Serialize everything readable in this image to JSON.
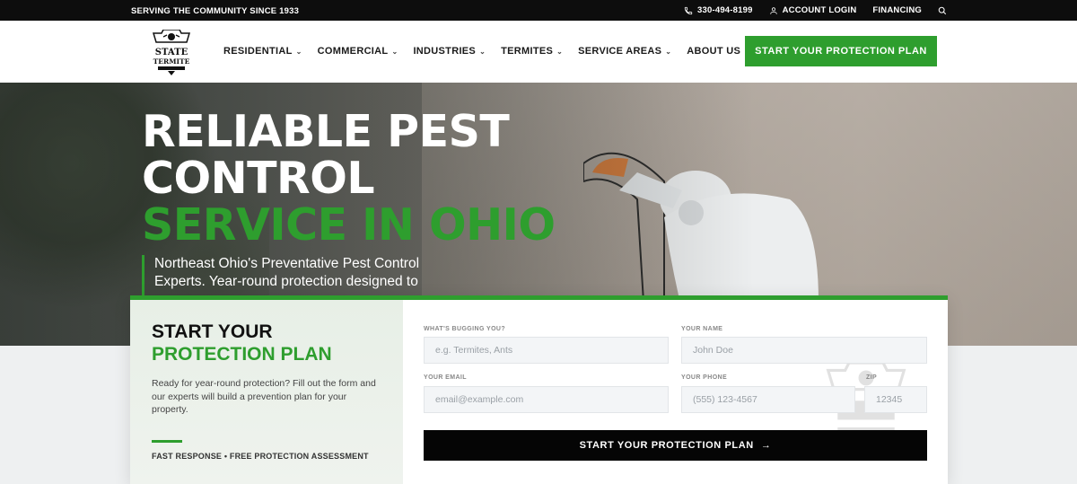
{
  "topbar": {
    "serving": "SERVING THE COMMUNITY SINCE 1933",
    "phone": "330-494-8199",
    "account": "ACCOUNT LOGIN",
    "financing": "FINANCING"
  },
  "nav": {
    "items": [
      "RESIDENTIAL",
      "COMMERCIAL",
      "INDUSTRIES",
      "TERMITES",
      "SERVICE AREAS",
      "ABOUT US"
    ],
    "cta": "START YOUR PROTECTION PLAN"
  },
  "logo": {
    "line1": "STATE",
    "line2": "TERMITE"
  },
  "hero": {
    "title_line1": "RELIABLE PEST",
    "title_line2": "CONTROL",
    "title_green": "SERVICE IN OHIO",
    "subtitle": "Northeast Ohio's Preventative Pest Control Experts. Year-round protection designed to"
  },
  "form": {
    "title_line1": "START YOUR",
    "title_line2": "PROTECTION PLAN",
    "description": "Ready for year-round protection? Fill out the form and our experts will build a prevention plan for your property.",
    "tagline": "FAST RESPONSE • FREE PROTECTION ASSESSMENT",
    "fields": {
      "bugging": {
        "label": "WHAT'S BUGGING YOU?",
        "placeholder": "e.g. Termites, Ants"
      },
      "name": {
        "label": "YOUR NAME",
        "placeholder": "John Doe"
      },
      "email": {
        "label": "YOUR EMAIL",
        "placeholder": "email@example.com"
      },
      "phone": {
        "label": "YOUR PHONE",
        "placeholder": "(555) 123-4567"
      },
      "zip": {
        "label": "ZIP",
        "placeholder": "12345"
      }
    },
    "submit": "START YOUR PROTECTION PLAN",
    "submit_arrow": "→"
  },
  "colors": {
    "accent": "#2e9e2e",
    "dark": "#0d0d0d"
  },
  "icons": [
    "phone-icon",
    "user-icon",
    "search-icon",
    "chevron-down-icon",
    "arrow-right-icon",
    "logo-icon"
  ]
}
